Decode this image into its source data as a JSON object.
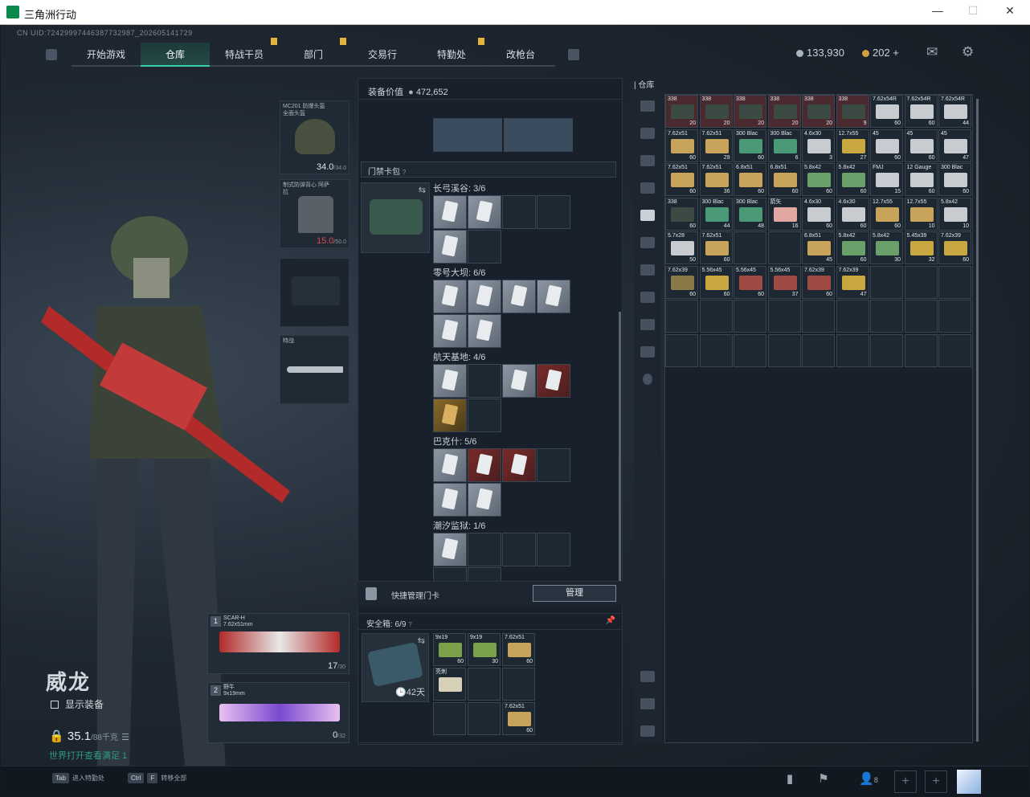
{
  "window": {
    "title": "三角洲行动",
    "min": "—",
    "max": "☐",
    "close": "✕"
  },
  "uid": "CN UID:72429997446387732987_202605141729",
  "nav": {
    "tabs": [
      "开始游戏",
      "仓库",
      "特战干员",
      "部门",
      "交易行",
      "特勤处",
      "改枪台"
    ],
    "active": 1
  },
  "currency": {
    "coins": "133,930",
    "bonds": "202 +"
  },
  "equipment": {
    "helmet": {
      "name": "MC201 防爆头盔 全面头盔",
      "value": "34.0",
      "max": "/34.0"
    },
    "armor": {
      "name": "制式防弹背心 阿萨拉",
      "value": "15.0",
      "max": "/50.0"
    },
    "melee": {
      "name": "特战"
    }
  },
  "weapons": [
    {
      "num": "1",
      "name": "SCAR-H",
      "caliber": "7.62x51mm",
      "ammo": "17",
      "max": "/30"
    },
    {
      "num": "2",
      "name": "野牛",
      "caliber": "9x19mm",
      "ammo": "0",
      "max": "/32"
    }
  ],
  "player": {
    "name": "威龙",
    "show_equip": "显示装备",
    "weight": "35.1",
    "weight_max": "/88千克",
    "hint": "世界打开查看满足 1"
  },
  "mid": {
    "equip_value_label": "装备价值",
    "equip_value": "472,652",
    "cardpack_label": "门禁卡包",
    "sections": [
      {
        "label": "长弓溪谷: 3/6"
      },
      {
        "label": "零号大坝: 6/6"
      },
      {
        "label": "航天基地: 4/6"
      },
      {
        "label": "巴克什: 5/6"
      },
      {
        "label": "潮汐监狱: 1/6"
      }
    ],
    "quick_manage": "快捷管理门卡",
    "manage_btn": "管理",
    "safe_label": "安全箱: 6/9",
    "safe_days": "42天",
    "safe_items": [
      {
        "name": "9x19",
        "count": "60"
      },
      {
        "name": "9x19",
        "count": "30"
      },
      {
        "name": "7.62x51",
        "count": "60"
      },
      {
        "name": "亮刺",
        "count": ""
      },
      {
        "name": "7.62x51",
        "count": "60"
      }
    ]
  },
  "stash": {
    "title": "仓库",
    "rows": [
      [
        [
          "338",
          "20",
          "#3c4a44"
        ],
        [
          "338",
          "20",
          "#3c4a44"
        ],
        [
          "338",
          "20",
          "#3c4a44"
        ],
        [
          "338",
          "20",
          "#3c4a44"
        ],
        [
          "338",
          "20",
          "#3c4a44"
        ],
        [
          "338",
          "9",
          "#3c4a44"
        ],
        [
          "7.62x54R",
          "60",
          "#c8ccd0"
        ],
        [
          "7.62x54R",
          "60",
          "#c8ccd0"
        ],
        [
          "7.62x54R",
          "44",
          "#c8ccd0"
        ]
      ],
      [
        [
          "7.62x51",
          "60",
          "#c8a35a"
        ],
        [
          "7.62x51",
          "29",
          "#c8a35a"
        ],
        [
          "300 Blac",
          "60",
          "#4a9a78"
        ],
        [
          "300 Blac",
          "6",
          "#4a9a78"
        ],
        [
          "4.6x30",
          "3",
          "#c8ccd0"
        ],
        [
          "12.7x55",
          "27",
          "#c8a640"
        ],
        [
          "45",
          "60",
          "#c8ccd0"
        ],
        [
          "45",
          "60",
          "#c8ccd0"
        ],
        [
          "45",
          "47",
          "#c8ccd0"
        ]
      ],
      [
        [
          "7.62x51",
          "60",
          "#c8a35a"
        ],
        [
          "7.62x51",
          "36",
          "#c8a35a"
        ],
        [
          "6.8x51",
          "60",
          "#c8a35a"
        ],
        [
          "6.8x51",
          "60",
          "#c8a35a"
        ],
        [
          "5.8x42",
          "60",
          "#6aa06a"
        ],
        [
          "5.8x42",
          "60",
          "#6aa06a"
        ],
        [
          "FMJ",
          "15",
          "#c8ccd0"
        ],
        [
          "12 Gauge",
          "60",
          "#c8ccd0"
        ],
        [
          "300 Blac",
          "60",
          "#c8ccd0"
        ]
      ],
      [
        [
          "338",
          "60",
          "#3c4a44"
        ],
        [
          "300 Blac",
          "44",
          "#4a9a78"
        ],
        [
          "300 Blac",
          "48",
          "#4a9a78"
        ],
        [
          "箭矢",
          "16",
          "#e0a8a0"
        ],
        [
          "4.6x30",
          "60",
          "#c8ccd0"
        ],
        [
          "4.6x30",
          "60",
          "#c8ccd0"
        ],
        [
          "12.7x55",
          "60",
          "#c8a35a"
        ],
        [
          "12.7x55",
          "10",
          "#c8a35a"
        ],
        [
          "5.8x42",
          "10",
          "#c8ccd0"
        ]
      ],
      [
        [
          "5.7x28",
          "50",
          "#c8ccd0"
        ],
        [
          "7.62x51",
          "60",
          "#c8a35a"
        ],
        [
          "",
          "",
          ""
        ],
        [
          "",
          "",
          ""
        ],
        [
          "6.8x51",
          "45",
          "#c8a35a"
        ],
        [
          "5.8x42",
          "60",
          "#6aa06a"
        ],
        [
          "5.8x42",
          "30",
          "#6aa06a"
        ],
        [
          "5.45x39",
          "32",
          "#c8a640"
        ],
        [
          "7.62x39",
          "60",
          "#c8a640"
        ]
      ],
      [
        [
          "7.62x39",
          "60",
          "#8a7a4a"
        ],
        [
          "5.56x45",
          "60",
          "#c8a640"
        ],
        [
          "5.56x45",
          "60",
          "#a04a44"
        ],
        [
          "5.56x45",
          "37",
          "#a04a44"
        ],
        [
          "7.62x39",
          "60",
          "#a04a44"
        ],
        [
          "7.62x39",
          "47",
          "#c8a640"
        ],
        [
          "",
          "",
          ""
        ],
        [
          "",
          "",
          ""
        ],
        [
          "",
          "",
          ""
        ]
      ]
    ]
  },
  "bottom": {
    "tab_key": "Tab",
    "tab_label": "进入特勤处",
    "ctrl_key": "Ctrl",
    "f_key": "F",
    "ctrl_label": "转移全部",
    "friends": "8"
  }
}
